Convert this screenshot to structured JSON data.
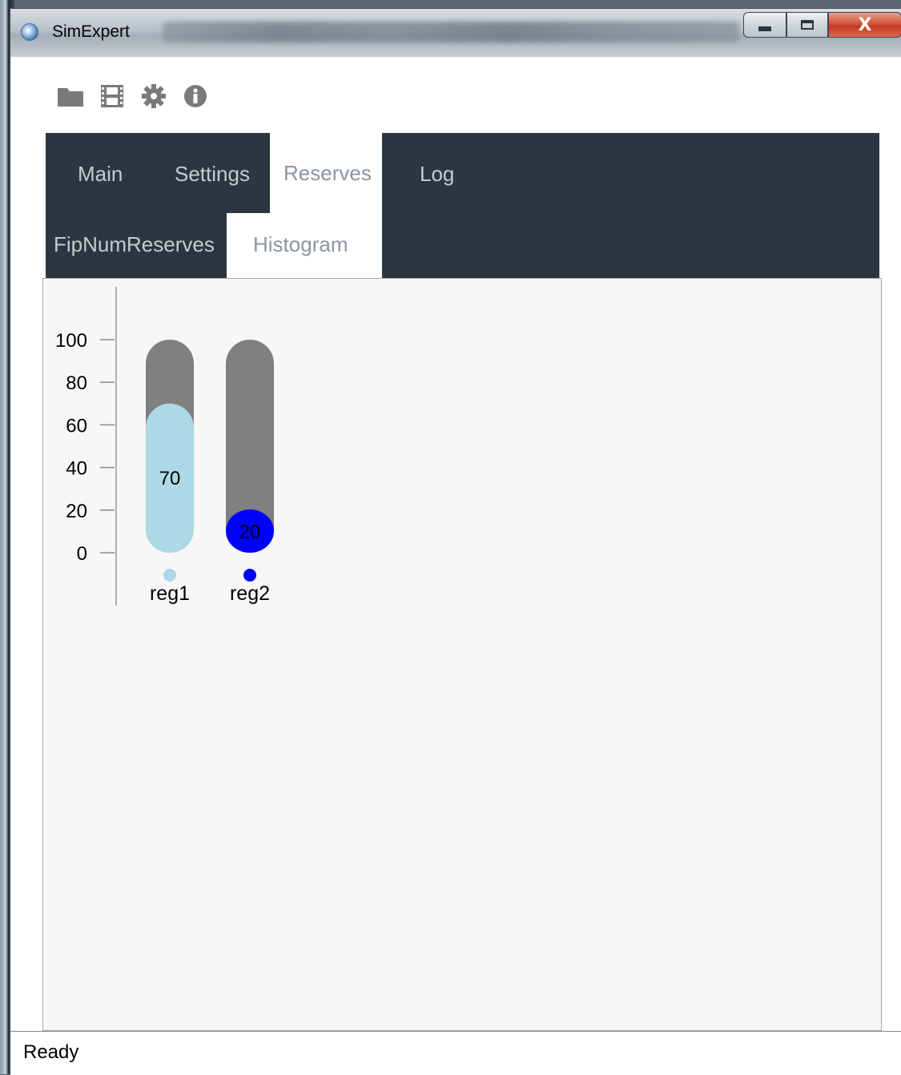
{
  "window": {
    "title": "SimExpert",
    "controls": {
      "minimize": "minimize",
      "maximize": "maximize",
      "close": "X"
    }
  },
  "toolbar": {
    "icons": [
      "folder-icon",
      "film-icon",
      "gear-icon",
      "info-icon"
    ]
  },
  "tabs": {
    "main": "Main",
    "settings": "Settings",
    "reserves": "Reserves",
    "log": "Log",
    "active": "Reserves"
  },
  "subtabs": {
    "fip": "FipNumReserves",
    "histogram": "Histogram",
    "active": "Histogram"
  },
  "chart_data": {
    "type": "bar",
    "categories": [
      "reg1",
      "reg2"
    ],
    "values": [
      70,
      20
    ],
    "max_values": [
      100,
      100
    ],
    "data_labels": [
      "70",
      "20"
    ],
    "colors": [
      "#add8e6",
      "#0000ff"
    ],
    "track_color": "#808080",
    "yticks": [
      "100",
      "80",
      "60",
      "40",
      "20",
      "0"
    ],
    "ylim": [
      0,
      100
    ],
    "legend": "markers below bars"
  },
  "status": {
    "text": "Ready"
  }
}
